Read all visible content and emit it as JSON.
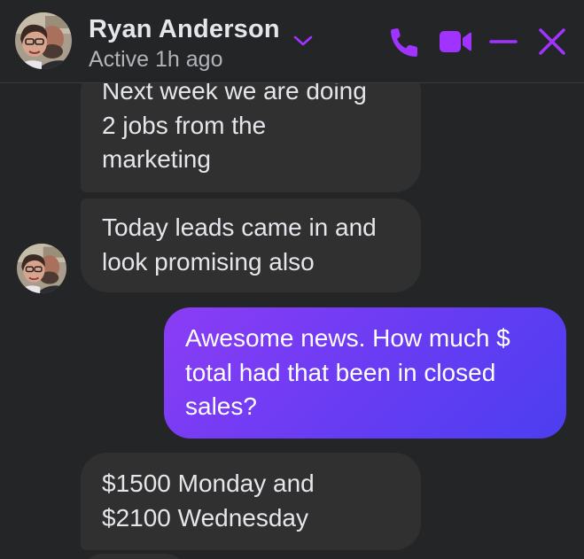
{
  "header": {
    "contact_name": "Ryan Anderson",
    "status": "Active 1h ago",
    "icons": [
      "phone-icon",
      "video-camera-icon",
      "minimize-icon",
      "close-icon",
      "chevron-down-icon"
    ],
    "accent_color": "#a033ff"
  },
  "messages": [
    {
      "sender": "contact",
      "lines": [
        "Next week we are doing",
        "2 jobs from the",
        "marketing"
      ]
    },
    {
      "sender": "contact",
      "lines": [
        "Today leads came in and",
        "look promising also"
      ]
    },
    {
      "sender": "me",
      "lines": [
        "Awesome news. How much $",
        "total had that been in closed",
        "sales?"
      ]
    },
    {
      "sender": "contact",
      "lines": [
        "$1500 Monday and",
        "$2100 Wednesday"
      ]
    }
  ],
  "colors": {
    "background": "#242526",
    "incoming_bubble": "#303030",
    "outgoing_gradient_start": "#8b3df5",
    "outgoing_gradient_end": "#4b3ef0",
    "text_primary": "#e4e6eb",
    "text_secondary": "#b0b3b8"
  }
}
